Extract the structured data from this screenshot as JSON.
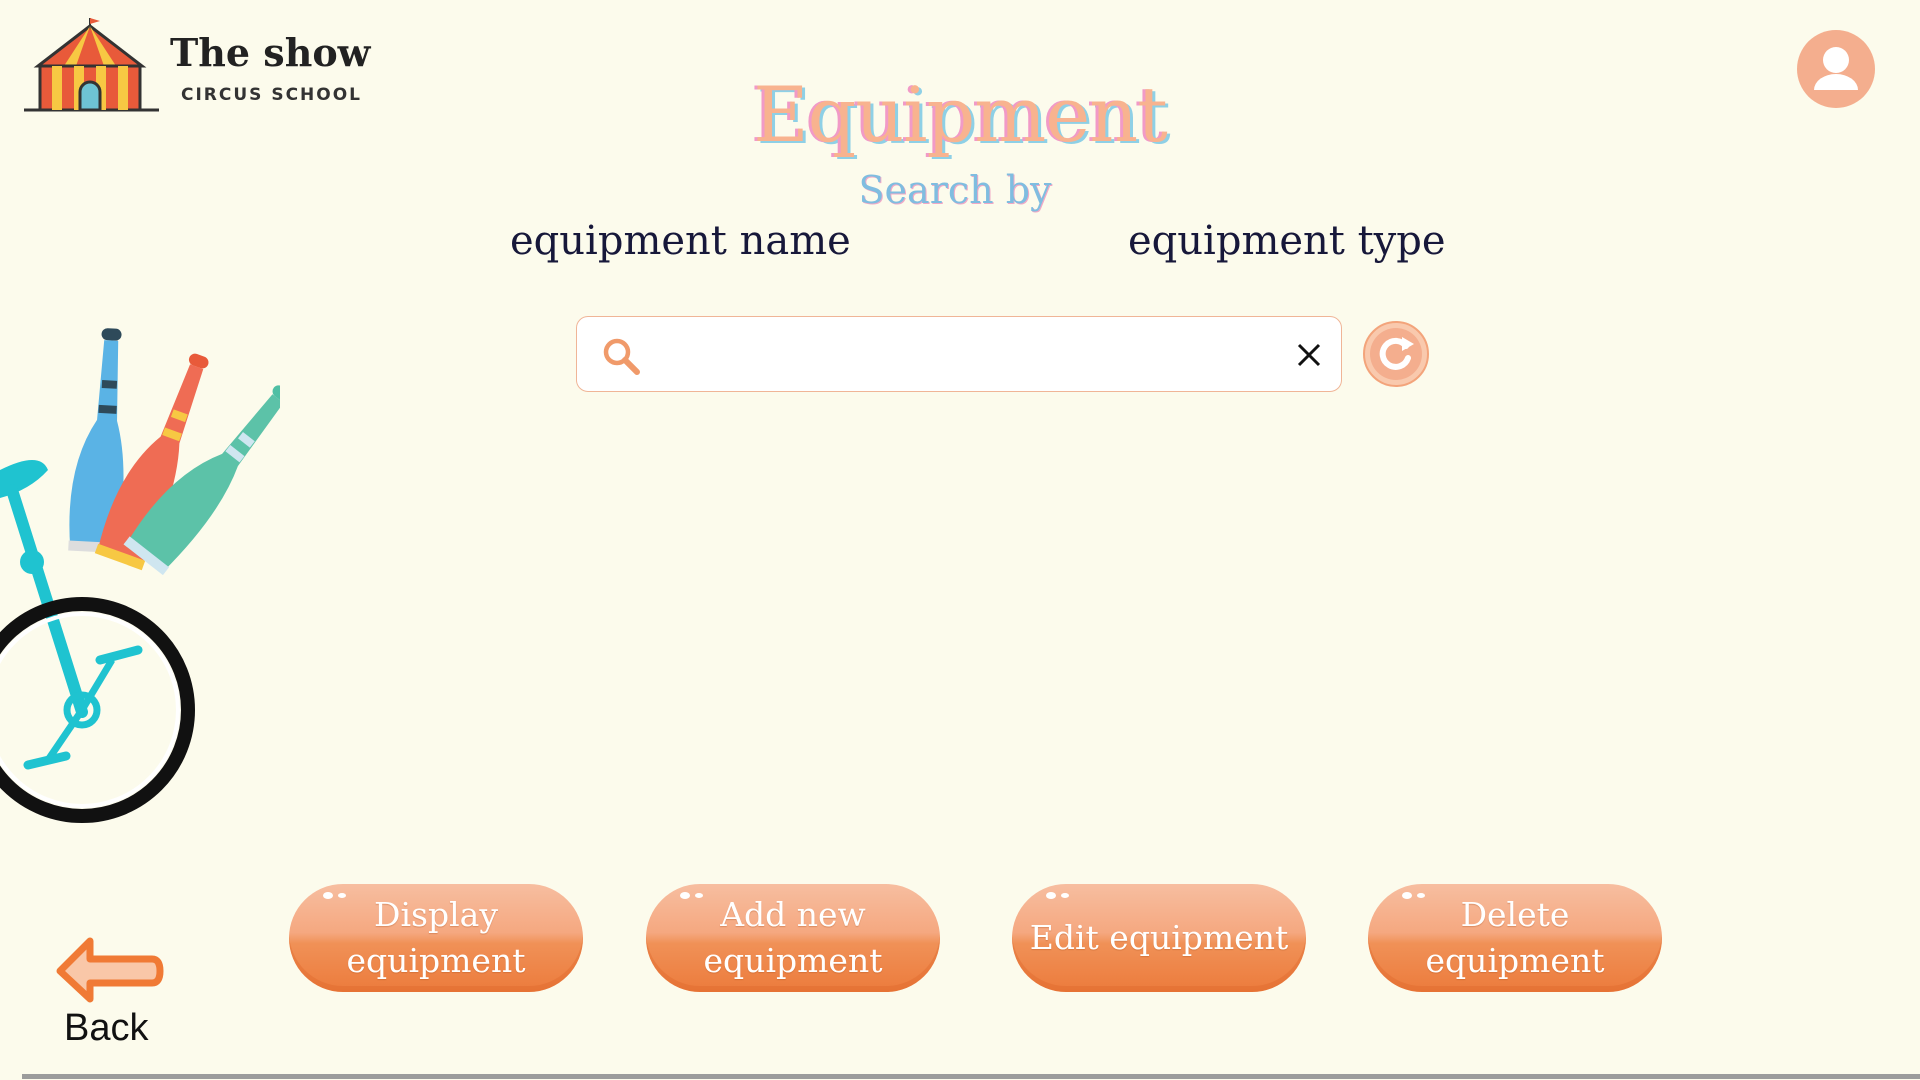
{
  "header": {
    "logo_title": "The show",
    "logo_subtitle": "CIRCUS SCHOOL",
    "profile_icon": "user-avatar-icon"
  },
  "main": {
    "title": "Equipment",
    "search_by": "Search by",
    "options": [
      "equipment name",
      "equipment type"
    ],
    "search": {
      "value": "",
      "placeholder": "",
      "search_icon": "search-icon",
      "clear_icon": "close-icon",
      "refresh_icon": "refresh-icon"
    }
  },
  "actions": {
    "display": "Display equipment",
    "add": "Add new equipment",
    "edit": "Edit equipment",
    "delete": "Delete equipment"
  },
  "footer": {
    "back": "Back",
    "back_icon": "arrow-left-icon"
  },
  "colors": {
    "background": "#fcfbec",
    "accent": "#f4ae8e",
    "button": "#f08d55",
    "title_pink": "#f19ac7",
    "title_blue": "#8ed0e6"
  }
}
